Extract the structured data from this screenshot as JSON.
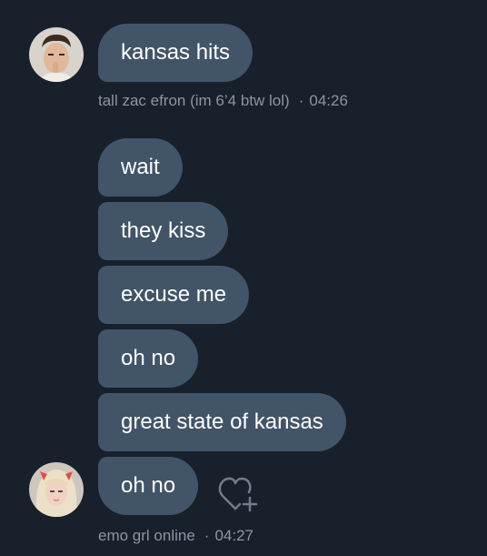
{
  "conversation": {
    "group1": {
      "messages": [
        "kansas hits"
      ],
      "sender": "tall zac efron (im 6’4 btw lol)",
      "time": "04:26"
    },
    "group2": {
      "messages": [
        "wait",
        "they kiss",
        "excuse me",
        "oh no",
        "great state of kansas",
        "oh no"
      ],
      "sender": "emo grl online",
      "time": "04:27"
    },
    "dot": "·"
  },
  "icons": {
    "react": "heart-plus-icon"
  },
  "colors": {
    "background": "#18202c",
    "bubble": "#425467",
    "meta_text": "#8a96a3",
    "bubble_text": "#ffffff"
  }
}
